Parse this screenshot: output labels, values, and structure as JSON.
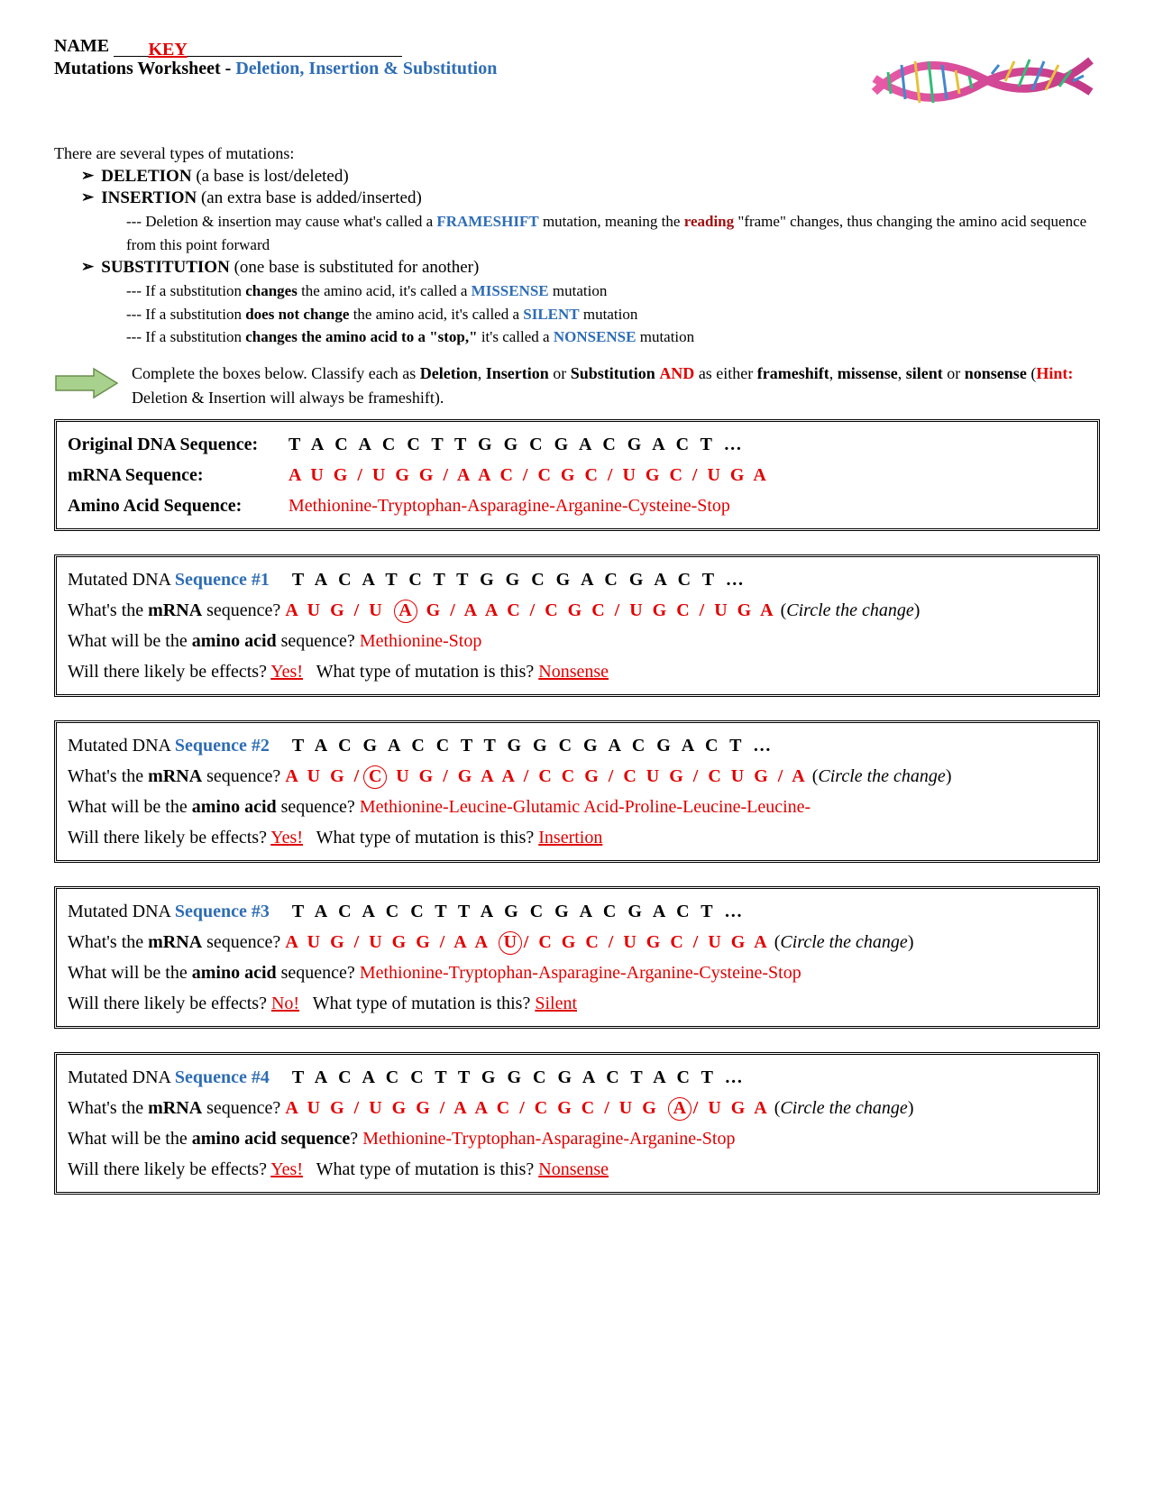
{
  "header": {
    "name_label": "NAME",
    "key": "KEY",
    "title_prefix": "Mutations Worksheet",
    "title_sep": " - ",
    "title_types": "Deletion, Insertion & Substitution"
  },
  "intro": "There are several types of mutations:",
  "bullets": {
    "deletion_name": "DELETION",
    "deletion_desc": " (a base is lost/deleted)",
    "insertion_name": "INSERTION",
    "insertion_desc": " (an extra base is added/inserted)",
    "frameshift_line_a": "--- Deletion & insertion may cause what's called a ",
    "frameshift_word": "FRAMESHIFT",
    "frameshift_line_b": " mutation, meaning the ",
    "reading_word": "reading",
    "frameshift_line_c": " \"frame\" changes, thus changing the amino acid sequence from this point forward",
    "substitution_name": "SUBSTITUTION",
    "substitution_desc": " (one base is substituted for another)",
    "sub_a1": "--- If a substitution ",
    "sub_a2": "changes",
    "sub_a3": " the amino acid, it's called a ",
    "sub_a4": "MISSENSE",
    "sub_a5": " mutation",
    "sub_b1": "--- If a substitution ",
    "sub_b2": "does not change",
    "sub_b3": " the amino acid, it's called a ",
    "sub_b4": "SILENT",
    "sub_b5": " mutation",
    "sub_c1": "--- If a substitution ",
    "sub_c2": "changes the amino acid to a \"stop,\"",
    "sub_c3": " it's called a ",
    "sub_c4": "NONSENSE",
    "sub_c5": " mutation"
  },
  "arrow": {
    "line1a": "Complete the boxes below.  Classify each as ",
    "d": "Deletion",
    "c1": ", ",
    "i": "Insertion",
    "or": " or ",
    "s": "Substitution",
    "sp": " ",
    "and": "AND",
    "line1b": " as either ",
    "fs": "frameshift",
    "ms": "missense",
    "sl": "silent",
    "ns": "nonsense",
    "hint_open": " (",
    "hint": "Hint:",
    "hint_text": " Deletion & Insertion will always be frameshift)."
  },
  "original": {
    "dna_label": "Original DNA Sequence:",
    "dna": "T A C A C C T T G G C G A C G A C T …",
    "mrna_label": "mRNA Sequence:",
    "mrna": "A U G / U G G / A A C / C G C / U G C / U G A",
    "aa_label": "Amino Acid Sequence:",
    "aa": "Methionine-Tryptophan-Asparagine-Arganine-Cysteine-Stop"
  },
  "questions": {
    "mrna_prefix": "What's the ",
    "mrna_bold": "mRNA",
    "mrna_suffix": " sequence? ",
    "circle_hint": "Circle the change",
    "aa_prefix": "What will be the ",
    "aa_bold": "amino acid",
    "aa_suffix": " sequence? ",
    "aa_bold2": "amino acid sequence",
    "effects_q": "Will there likely be effects? ",
    "type_q": "   What type of mutation is this? "
  },
  "seq1": {
    "title_a": "Mutated DNA ",
    "title_b": "Sequence #1",
    "dna": "T A C A T C T T G G C G A C G A C T …",
    "mrna_a": "A U G / U ",
    "mrna_circ": "A",
    "mrna_b": " G / A A C / C G C / U G C / U G A",
    "aa": "Methionine-Stop",
    "effects": "Yes!",
    "type": "Nonsense"
  },
  "seq2": {
    "title_a": "Mutated DNA ",
    "title_b": "Sequence #2",
    "dna": "T A C G A C C T T G G C G A C G A C T …",
    "mrna_a": "A U G /",
    "mrna_circ": "C",
    "mrna_b": " U G / G A A / C C G / C U G / C U G / A",
    "aa": "Methionine-Leucine-Glutamic Acid-Proline-Leucine-Leucine-",
    "effects": "Yes!",
    "type": "Insertion"
  },
  "seq3": {
    "title_a": "Mutated DNA ",
    "title_b": "Sequence #3",
    "dna": "T A C A C C T T A G C G A C G A C T …",
    "mrna_a": "A U G / U G G / A A ",
    "mrna_circ": "U",
    "mrna_b": "/ C G C / U G C / U G A",
    "aa": "Methionine-Tryptophan-Asparagine-Arganine-Cysteine-Stop",
    "effects": "No!",
    "type": "Silent"
  },
  "seq4": {
    "title_a": "Mutated DNA ",
    "title_b": "Sequence #4",
    "dna": "T A C A C C T T G G C G A C T A C T …",
    "mrna_a": "A U G / U G G / A A C / C G C / U G ",
    "mrna_circ": "A",
    "mrna_b": "/ U G A",
    "aa": "Methionine-Tryptophan-Asparagine-Arganine-Stop",
    "effects": "Yes!",
    "type": "Nonsense"
  }
}
